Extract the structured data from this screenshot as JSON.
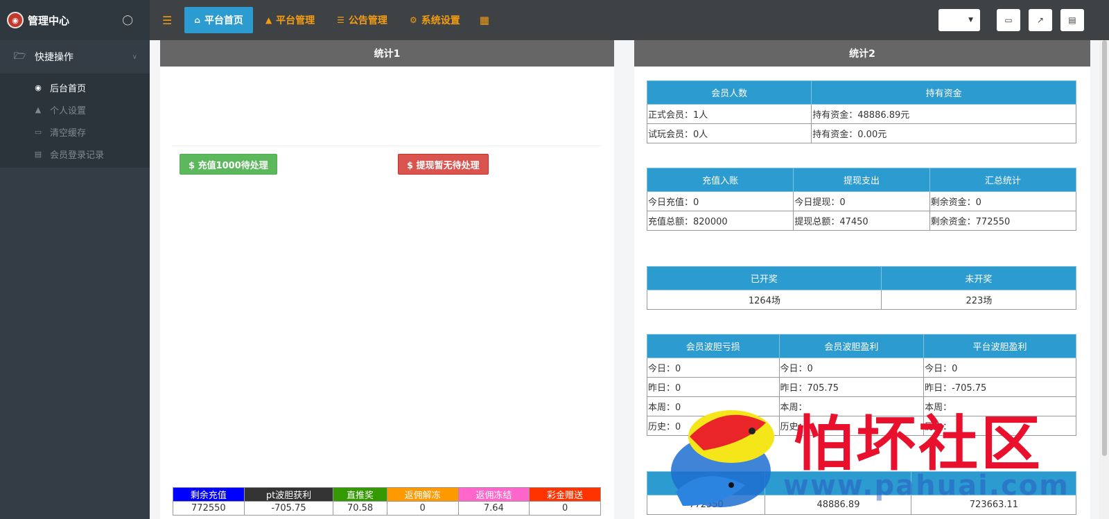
{
  "sidebar": {
    "brand_title": "管理中心",
    "group_label": "快捷操作",
    "items": [
      {
        "label": "后台首页",
        "icon": "dashboard-icon"
      },
      {
        "label": "个人设置",
        "icon": "user-icon"
      },
      {
        "label": "清空缓存",
        "icon": "trash-icon"
      },
      {
        "label": "会员登录记录",
        "icon": "list-icon"
      }
    ]
  },
  "topnav": {
    "tabs": [
      {
        "label": "平台首页",
        "icon": "home-icon"
      },
      {
        "label": "平台管理",
        "icon": "user-icon"
      },
      {
        "label": "公告管理",
        "icon": "list-icon"
      },
      {
        "label": "系统设置",
        "icon": "gear-icon"
      }
    ]
  },
  "panel1": {
    "title": "统计1",
    "recharge_button": "$ 充值1000待处理",
    "withdraw_button": "$ 提现暂无待处理",
    "summary": {
      "headers": [
        "剩余充值",
        "pt波胆获利",
        "直推奖",
        "返佣解冻",
        "返佣冻结",
        "彩金赠送"
      ],
      "header_colors": [
        "#0000ff",
        "#333333",
        "#339900",
        "#ff9900",
        "#ff66cc",
        "#ff3300"
      ],
      "values": [
        "772550",
        "-705.75",
        "70.58",
        "0",
        "7.64",
        "0"
      ]
    }
  },
  "panel2": {
    "title": "统计2",
    "members": {
      "headers": [
        "会员人数",
        "持有资金"
      ],
      "rows": [
        [
          "正式会员：1人",
          "持有资金：48886.89元"
        ],
        [
          "试玩会员：0人",
          "持有资金：0.00元"
        ]
      ]
    },
    "finance": {
      "headers": [
        "充值入账",
        "提现支出",
        "汇总统计"
      ],
      "rows": [
        [
          "今日充值：0",
          "今日提现：0",
          "剩余资金：0"
        ],
        [
          "充值总额：820000",
          "提现总额：47450",
          "剩余资金：772550"
        ]
      ]
    },
    "lottery": {
      "headers": [
        "已开奖",
        "未开奖"
      ],
      "values": [
        "1264场",
        "223场"
      ]
    },
    "bets": {
      "headers": [
        "会员波胆亏损",
        "会员波胆盈利",
        "平台波胆盈利"
      ],
      "rows": [
        [
          "今日：0",
          "今日：0",
          "今日：0"
        ],
        [
          "昨日：0",
          "昨日：705.75",
          "昨日：-705.75"
        ],
        [
          "本周：0",
          "本周：",
          "本周："
        ],
        [
          "历史：0",
          "历史：",
          "历史："
        ]
      ]
    },
    "totals": {
      "values": [
        "772550",
        "48886.89",
        "723663.11"
      ]
    }
  },
  "watermark": {
    "text": "怕坏社区",
    "url": "www.pahuai.com"
  }
}
